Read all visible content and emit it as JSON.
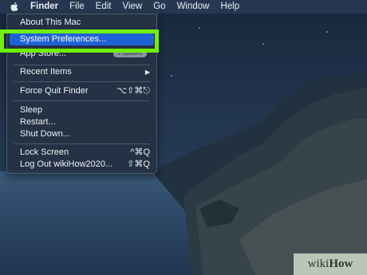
{
  "menubar": {
    "apple_icon": "apple-logo-icon",
    "items": [
      "Finder",
      "File",
      "Edit",
      "View",
      "Go",
      "Window",
      "Help"
    ]
  },
  "apple_menu": {
    "about": "About This Mac",
    "system_preferences": "System Preferences...",
    "app_store": "App Store...",
    "app_store_badge": "2 updates",
    "recent_items": "Recent Items",
    "recent_items_arrow": "▶",
    "force_quit": "Force Quit Finder",
    "force_quit_shortcut": "⌥⇧⌘⎋",
    "sleep": "Sleep",
    "restart": "Restart...",
    "shut_down": "Shut Down...",
    "lock_screen": "Lock Screen",
    "lock_screen_shortcut": "^⌘Q",
    "log_out": "Log Out wikiHow2020...",
    "log_out_shortcut": "⇧⌘Q"
  },
  "highlight_color": "#6ff000",
  "selection_color": "#1e63d6",
  "watermark": {
    "prefix": "wiki",
    "suffix": "How"
  }
}
